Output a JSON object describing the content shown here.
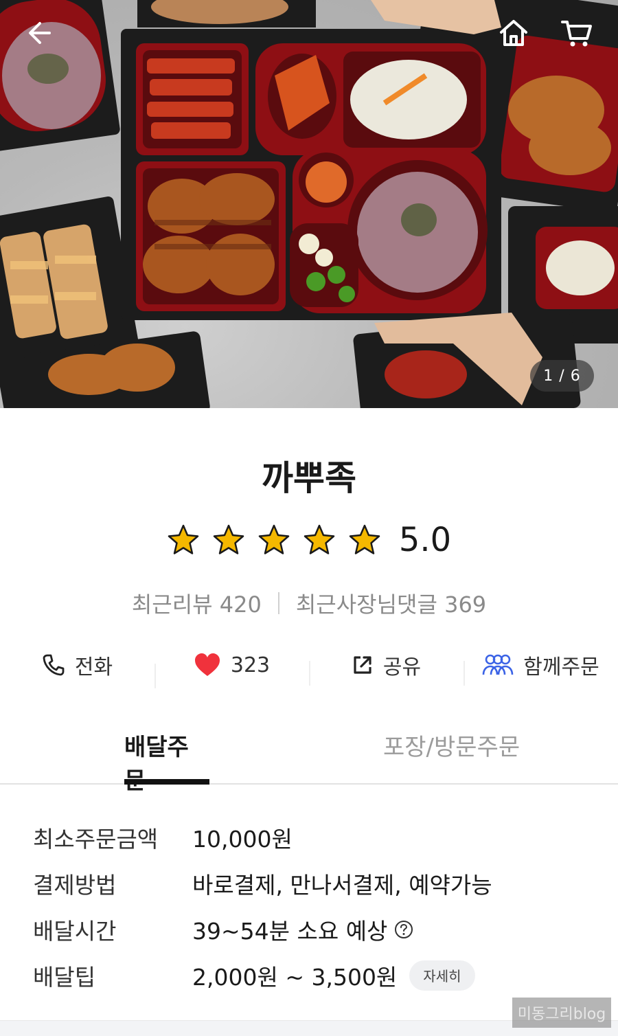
{
  "hero": {
    "image_counter": "1 / 6",
    "icons": {
      "back": "arrow-left-icon",
      "home": "home-icon",
      "cart": "cart-icon"
    }
  },
  "store": {
    "name": "까뿌족",
    "rating": 5.0,
    "rating_text": "5.0",
    "stars_filled": 5,
    "stars_total": 5,
    "recent_reviews": "최근리뷰 420",
    "owner_replies": "최근사장님댓글 369"
  },
  "actions": [
    {
      "label": "전화",
      "icon": "phone-icon"
    },
    {
      "label": "323",
      "icon": "heart-icon"
    },
    {
      "label": "공유",
      "icon": "share-icon"
    },
    {
      "label": "함께주문",
      "icon": "group-icon"
    }
  ],
  "tabs": [
    {
      "label": "배달주문",
      "active": true
    },
    {
      "label": "포장/방문주문",
      "active": false
    }
  ],
  "info": [
    {
      "label": "최소주문금액",
      "value": "10,000원"
    },
    {
      "label": "결제방법",
      "value": "바로결제, 만나서결제, 예약가능"
    },
    {
      "label": "배달시간",
      "value": "39~54분 소요 예상"
    },
    {
      "label": "배달팁",
      "value": "2,000원 ~ 3,500원",
      "button": "자세히"
    }
  ],
  "watermark": "미동그리blog",
  "colors": {
    "star": "#f5b800",
    "heart": "#f0323c",
    "group_icon": "#3b63e6",
    "tray_red": "#8e0f14",
    "tray_black": "#1c1c1c"
  }
}
